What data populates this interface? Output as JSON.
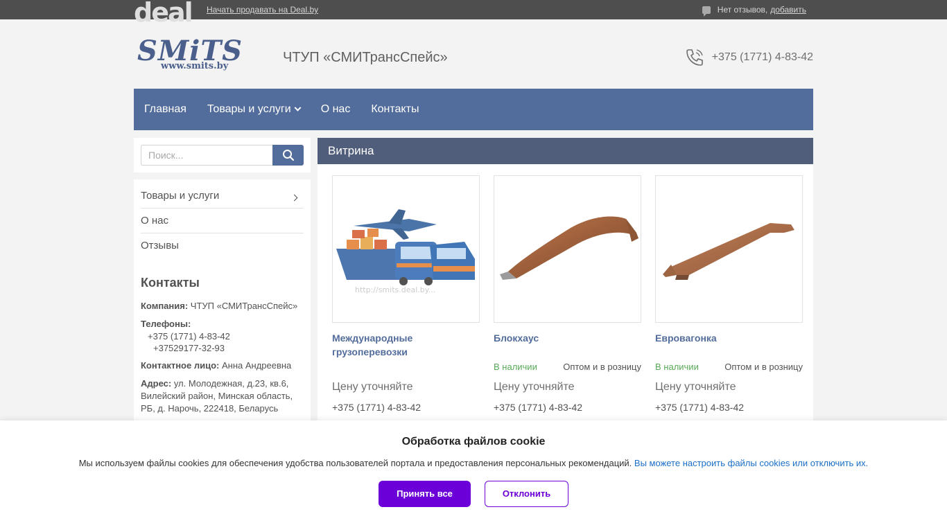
{
  "topbar": {
    "logo": "deal",
    "sell_link": "Начать продавать на Deal.by",
    "reviews_text": "Нет отзывов,",
    "reviews_add": "добавить"
  },
  "header": {
    "brand_big": "SMiTS",
    "brand_small": "www.smits.by",
    "company": "ЧТУП «СМИТрансСпейс»",
    "phone": "+375 (1771) 4-83-42"
  },
  "nav": [
    {
      "label": "Главная"
    },
    {
      "label": "Товары и услуги"
    },
    {
      "label": "О нас"
    },
    {
      "label": "Контакты"
    }
  ],
  "search": {
    "placeholder": "Поиск..."
  },
  "sidebar": {
    "items": [
      {
        "label": "Товары и услуги"
      },
      {
        "label": "О нас"
      },
      {
        "label": "Отзывы"
      }
    ],
    "contacts_title": "Контакты",
    "company_label": "Компания:",
    "company_value": "ЧТУП «СМИТрансСпейс»",
    "phones_label": "Телефоны:",
    "phone1": "+375 (1771) 4-83-42",
    "phone2": "+37529177-32-93",
    "person_label": "Контактное лицо:",
    "person_value": "Анна Андреевна",
    "address_label": "Адрес:",
    "address_value": "ул. Молодежная, д.23, кв.6, Вилейский район, Минская область, РБ, д. Нарочь, 222418, Беларусь"
  },
  "main": {
    "title": "Витрина",
    "products": [
      {
        "title": "Международные грузоперевозки",
        "availability": "",
        "sale_type": "",
        "price": "Цену уточняйте",
        "phone": "+375 (1771) 4-83-42",
        "watermark": "http://smits.deal.by..."
      },
      {
        "title": "Блокхаус",
        "availability": "В наличии",
        "sale_type": "Оптом и в розницу",
        "price": "Цену уточняйте",
        "phone": "+375 (1771) 4-83-42"
      },
      {
        "title": "Евровагонка",
        "availability": "В наличии",
        "sale_type": "Оптом и в розницу",
        "price": "Цену уточняйте",
        "phone": "+375 (1771) 4-83-42"
      }
    ]
  },
  "cookie": {
    "title": "Обработка файлов cookie",
    "text": "Мы используем файлы cookies для обеспечения удобства пользователей портала и предоставления персональных рекомендаций.",
    "link": "Вы можете настроить файлы cookies или отключить их.",
    "accept": "Принять все",
    "decline": "Отклонить"
  }
}
